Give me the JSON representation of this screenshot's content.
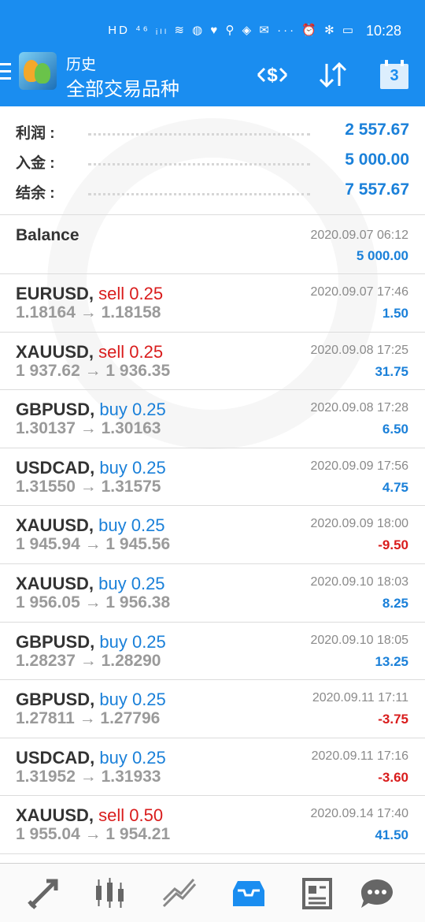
{
  "status_bar": {
    "icons": "HD ⁴⁶ ᵢₗₗ ≋ ◍ ♥ ⚲ ◈ ✉ ··· ⏰ ✻ ▭",
    "time": "10:28"
  },
  "app_bar": {
    "title": "历史",
    "subtitle": "全部交易品种",
    "calendar_day": "3"
  },
  "summary": [
    {
      "label": "利润 :",
      "value": "2 557.67"
    },
    {
      "label": "入金 :",
      "value": "5 000.00"
    },
    {
      "label": "结余 :",
      "value": "7 557.67"
    }
  ],
  "balance": {
    "label": "Balance",
    "time": "2020.09.07 06:12",
    "amount": "5 000.00"
  },
  "deals": [
    {
      "symbol": "EURUSD,",
      "type": "sell 0.25",
      "side": "sell",
      "prices": "1.18164 → 1.18158",
      "time": "2020.09.07 17:46",
      "profit": "1.50",
      "sign": "pos"
    },
    {
      "symbol": "XAUUSD,",
      "type": "sell 0.25",
      "side": "sell",
      "prices": "1 937.62 → 1 936.35",
      "time": "2020.09.08 17:25",
      "profit": "31.75",
      "sign": "pos"
    },
    {
      "symbol": "GBPUSD,",
      "type": "buy 0.25",
      "side": "buy",
      "prices": "1.30137 → 1.30163",
      "time": "2020.09.08 17:28",
      "profit": "6.50",
      "sign": "pos"
    },
    {
      "symbol": "USDCAD,",
      "type": "buy 0.25",
      "side": "buy",
      "prices": "1.31550 → 1.31575",
      "time": "2020.09.09 17:56",
      "profit": "4.75",
      "sign": "pos"
    },
    {
      "symbol": "XAUUSD,",
      "type": "buy 0.25",
      "side": "buy",
      "prices": "1 945.94 → 1 945.56",
      "time": "2020.09.09 18:00",
      "profit": "-9.50",
      "sign": "neg"
    },
    {
      "symbol": "XAUUSD,",
      "type": "buy 0.25",
      "side": "buy",
      "prices": "1 956.05 → 1 956.38",
      "time": "2020.09.10 18:03",
      "profit": "8.25",
      "sign": "pos"
    },
    {
      "symbol": "GBPUSD,",
      "type": "buy 0.25",
      "side": "buy",
      "prices": "1.28237 → 1.28290",
      "time": "2020.09.10 18:05",
      "profit": "13.25",
      "sign": "pos"
    },
    {
      "symbol": "GBPUSD,",
      "type": "buy 0.25",
      "side": "buy",
      "prices": "1.27811 → 1.27796",
      "time": "2020.09.11 17:11",
      "profit": "-3.75",
      "sign": "neg"
    },
    {
      "symbol": "USDCAD,",
      "type": "buy 0.25",
      "side": "buy",
      "prices": "1.31952 → 1.31933",
      "time": "2020.09.11 17:16",
      "profit": "-3.60",
      "sign": "neg"
    },
    {
      "symbol": "XAUUSD,",
      "type": "sell 0.50",
      "side": "sell",
      "prices": "1 955.04 → 1 954.21",
      "time": "2020.09.14 17:40",
      "profit": "41.50",
      "sign": "pos"
    }
  ],
  "bottom_nav": [
    "quotes-icon",
    "chart-icon",
    "trade-icon",
    "history-icon",
    "news-icon",
    "chat-icon"
  ],
  "colors": {
    "accent": "#1a8df0",
    "profit_positive": "#1a80d9",
    "profit_negative": "#d91c1c"
  }
}
